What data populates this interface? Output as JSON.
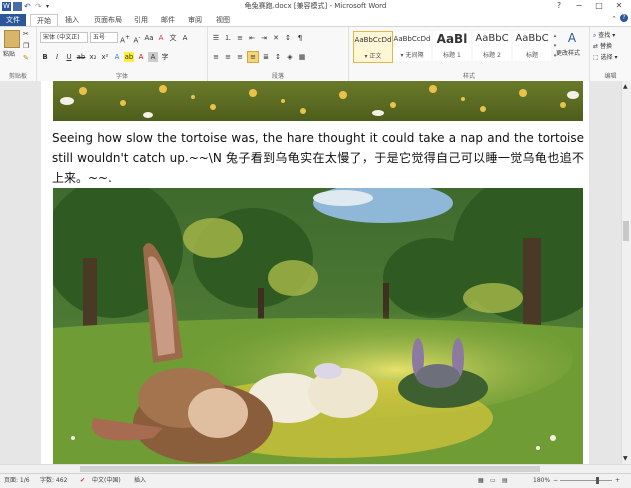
{
  "window": {
    "title": "龟兔赛跑.docx [兼容模式] - Microsoft Word",
    "controls": [
      "?",
      "−",
      "□",
      "✕"
    ]
  },
  "quick_access": [
    "save-icon",
    "undo-icon",
    "redo-icon"
  ],
  "ribbon_tabs": [
    "文件",
    "开始",
    "插入",
    "页面布局",
    "引用",
    "邮件",
    "审阅",
    "视图"
  ],
  "ribbon": {
    "clipboard": {
      "paste_label": "粘贴",
      "group_label": "剪贴板"
    },
    "font": {
      "font_name": "宋体 (中文正)",
      "font_size": "五号",
      "group_label": "字体"
    },
    "paragraph": {
      "group_label": "段落"
    },
    "styles": {
      "items": [
        {
          "preview": "AaBbCcDd",
          "name": "▾ 正文"
        },
        {
          "preview": "AaBbCcDd",
          "name": "▾ 无间隔"
        },
        {
          "preview": "AaBl",
          "name": "标题 1"
        },
        {
          "preview": "AaBbC",
          "name": "标题 2"
        },
        {
          "preview": "AaBbC",
          "name": "标题"
        }
      ],
      "change_styles": "更改样式",
      "group_label": "样式"
    },
    "editing": {
      "find": "查找 ▾",
      "replace": "替换",
      "select": "选择 ▾",
      "group_label": "编辑"
    }
  },
  "document": {
    "paragraph": "Seeing how slow the tortoise was, the hare thought it could take a nap and the tortoise still wouldn't catch up.~~\\N 兔子看到乌龟实在太慢了，于是它觉得自己可以睡一觉乌龟也追不上来。~~."
  },
  "status_bar": {
    "page": "页面: 1/6",
    "words": "字数: 462",
    "language": "中文(中国)",
    "mode": "插入",
    "zoom": "180%"
  },
  "colors": {
    "file_tab": "#2b579a",
    "ribbon_bg": "#f8f8f8",
    "doc_bg": "#e6e6e6"
  }
}
